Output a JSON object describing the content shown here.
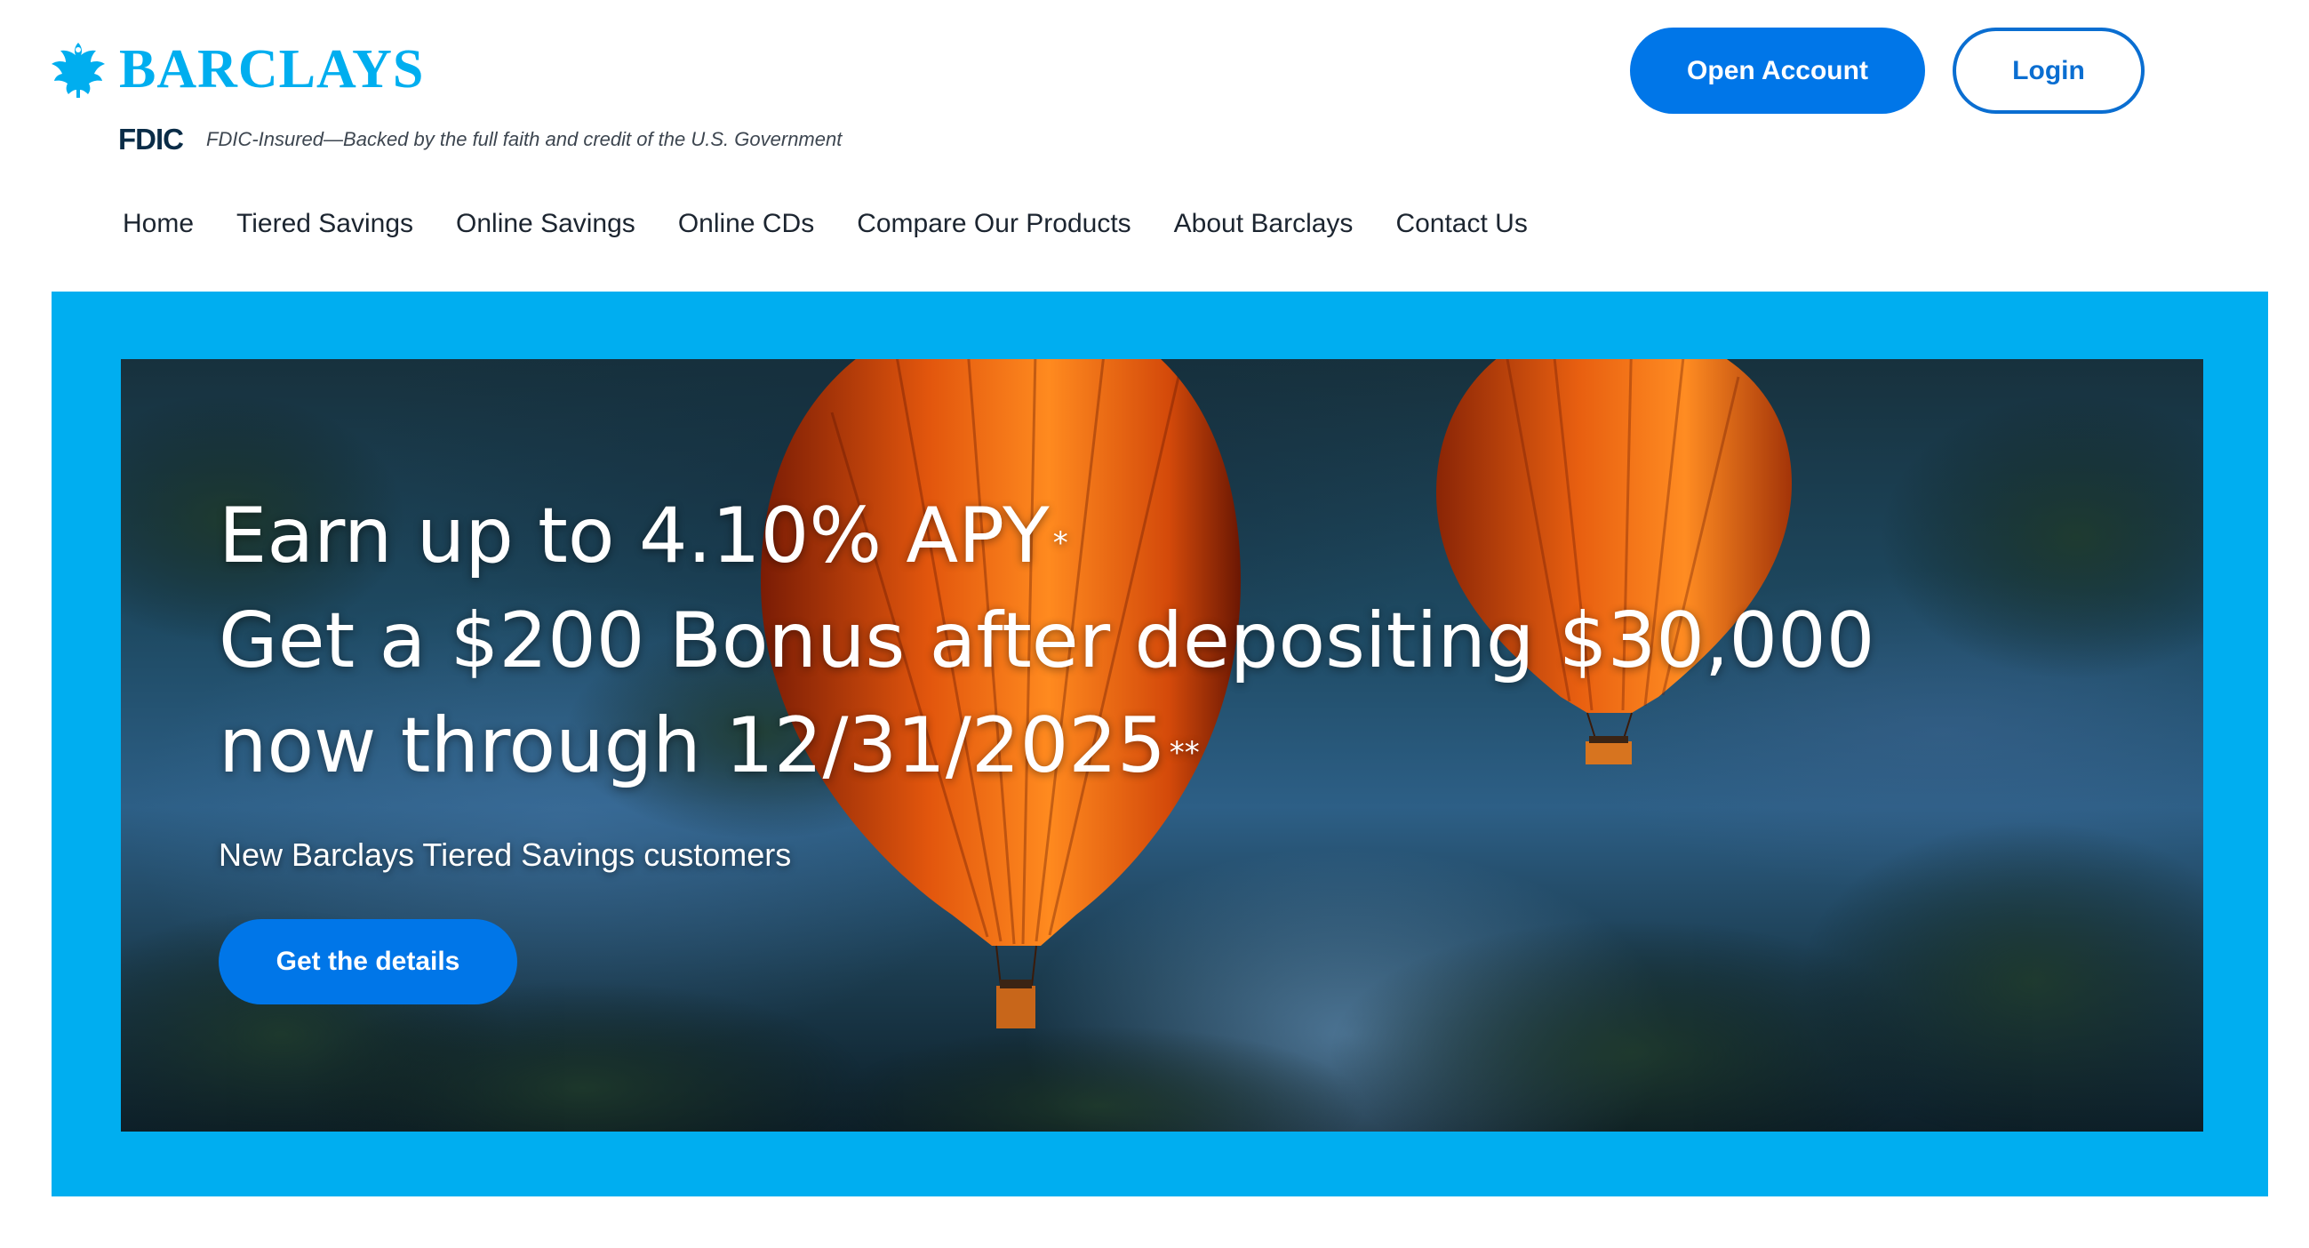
{
  "brand": {
    "name": "BARCLAYS",
    "logo_icon": "eagle-icon",
    "color": "#00aeef"
  },
  "fdic": {
    "logo": "FDIC",
    "text": "FDIC-Insured—Backed by the full faith and credit of the U.S. Government"
  },
  "header": {
    "open_account_label": "Open Account",
    "login_label": "Login"
  },
  "nav": {
    "items": [
      "Home",
      "Tiered Savings",
      "Online Savings",
      "Online CDs",
      "Compare Our Products",
      "About Barclays",
      "Contact Us"
    ]
  },
  "hero": {
    "line1": "Earn up to 4.10% APY",
    "line1_mark": "*",
    "line2": "Get a $200 Bonus after depositing $30,000",
    "line3": "now through 12/31/2025",
    "line3_mark": "**",
    "subline": "New Barclays Tiered Savings customers",
    "cta_label": "Get the details",
    "frame_color": "#00aef0",
    "button_color": "#0076e8"
  }
}
